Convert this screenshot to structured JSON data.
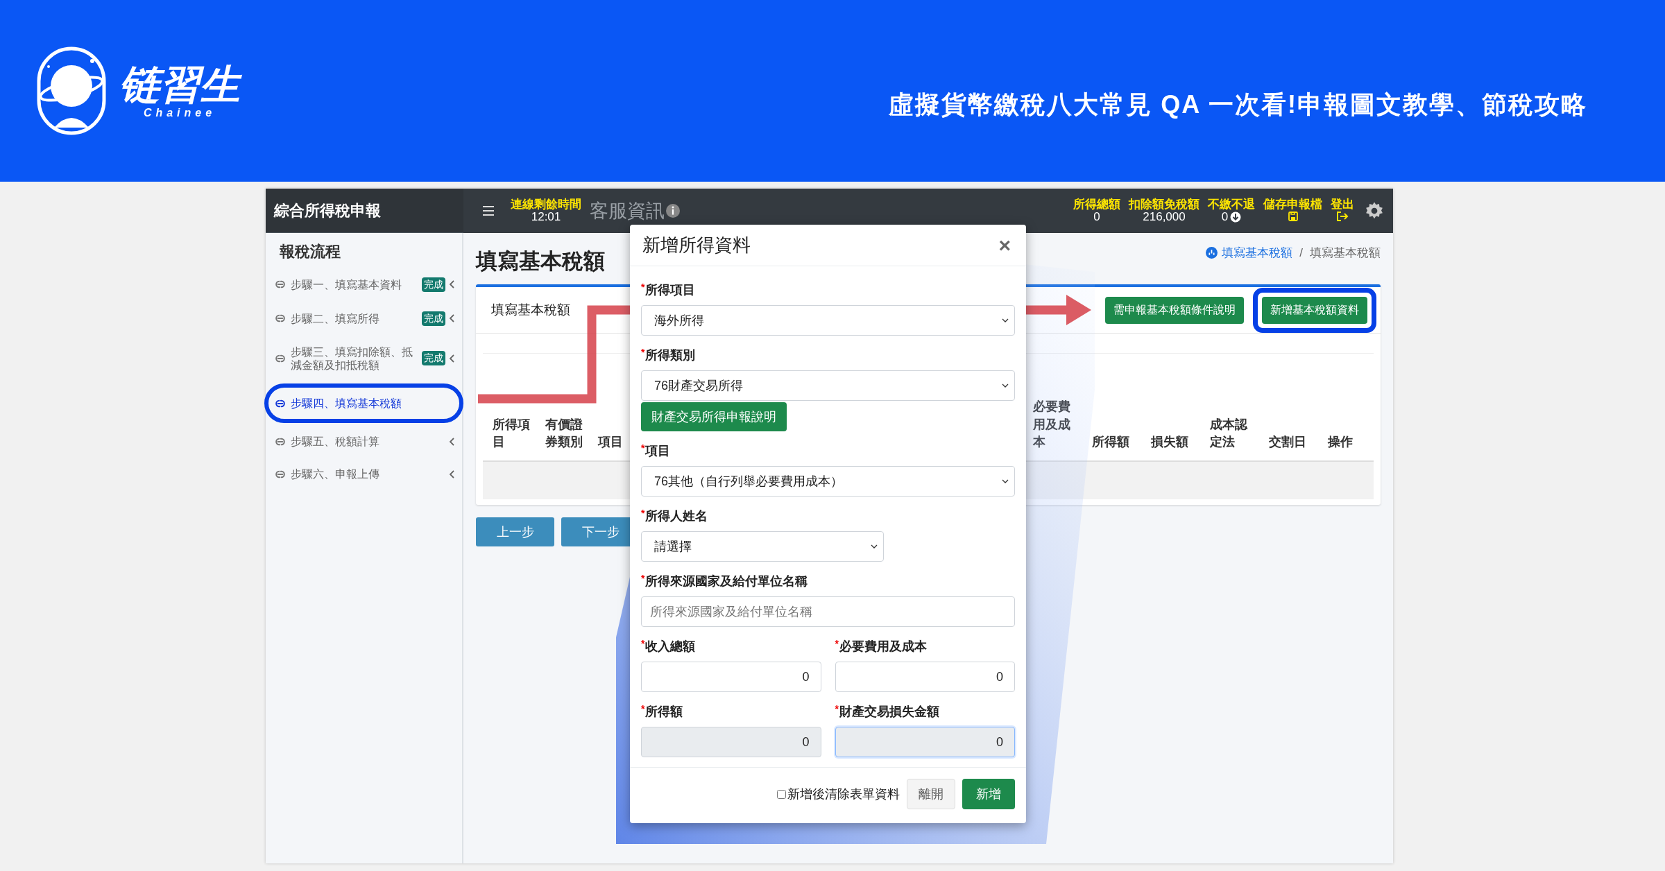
{
  "banner": {
    "logo": {
      "name": "链習生",
      "tagline": "Chainee"
    },
    "title": "虛擬貨幣繳稅八大常見 QA 一次看!申報圖文教學、節稅攻略"
  },
  "topbar": {
    "brand": "綜合所得稅申報",
    "timer": {
      "label": "連線剩餘時間",
      "value": "12:01"
    },
    "support": "客服資訊",
    "stats": [
      {
        "kind": "amount",
        "label": "所得總額",
        "value": "0"
      },
      {
        "kind": "amount",
        "label": "扣除額免稅額",
        "value": "216,000"
      },
      {
        "kind": "status",
        "label": "不繳不退",
        "value": "0"
      },
      {
        "kind": "save",
        "label": "儲存申報檔"
      },
      {
        "kind": "logout",
        "label": "登出"
      }
    ]
  },
  "sidebar": {
    "title": "報稅流程",
    "items": [
      {
        "label": "步驟一、填寫基本資料",
        "badge": "完成",
        "selected": false,
        "highlighted": false
      },
      {
        "label": "步驟二、填寫所得",
        "badge": "完成",
        "selected": false,
        "highlighted": false
      },
      {
        "label": "步驟三、填寫扣除額、抵減金額及扣抵稅額",
        "badge": "完成",
        "selected": false,
        "highlighted": false
      },
      {
        "label": "步驟四、填寫基本稅額",
        "selected": true,
        "highlighted": true
      },
      {
        "label": "步驟五、稅額計算",
        "selected": false,
        "highlighted": false
      },
      {
        "label": "步驟六、申報上傳",
        "selected": false,
        "highlighted": false
      }
    ]
  },
  "content": {
    "title": "填寫基本稅額",
    "breadcrumb_separator": "/",
    "breadcrumb": [
      {
        "label": "填寫基本稅額",
        "link": true
      },
      {
        "label": "填寫基本稅額",
        "link": false
      }
    ],
    "card": {
      "title": "填寫基本稅額",
      "buttons": [
        {
          "label": "需申報基本稅額條件說明",
          "highlighted": false
        },
        {
          "label": "新增基本稅額資料",
          "highlighted": true
        }
      ],
      "columns": [
        "所得項目",
        "有價證券類別",
        "項目",
        "必要費用及成本",
        "所得額",
        "損失額",
        "成本認定法",
        "交割日",
        "操作"
      ]
    },
    "nav_buttons": [
      "上一步",
      "下一步"
    ]
  },
  "modal": {
    "title": "新增所得資料",
    "close": "×",
    "rows": [
      {
        "kind": "full",
        "fields": [
          {
            "kind": "select",
            "mark": "*",
            "label": "所得項目",
            "value": "海外所得"
          }
        ]
      },
      {
        "kind": "full",
        "fields": [
          {
            "kind": "select",
            "mark": "*",
            "label": "所得類別",
            "value": "76財產交易所得"
          },
          {
            "kind": "button",
            "label": "財產交易所得申報說明"
          }
        ]
      },
      {
        "kind": "full",
        "fields": [
          {
            "kind": "select",
            "mark": "*",
            "label": "項目",
            "value": "76其他（自行列舉必要費用成本）"
          }
        ]
      },
      {
        "kind": "short",
        "fields": [
          {
            "kind": "select",
            "mark": "*",
            "label": "所得人姓名",
            "value": "請選擇"
          }
        ]
      },
      {
        "kind": "full",
        "fields": [
          {
            "kind": "text",
            "mark": "*",
            "label": "所得來源國家及給付單位名稱",
            "placeholder": "所得來源國家及給付單位名稱"
          }
        ]
      },
      {
        "kind": "pair",
        "fields": [
          {
            "kind": "number",
            "mark": "*",
            "label": "收入總額",
            "value": "0",
            "readonly": false,
            "focused": false
          },
          {
            "kind": "number",
            "mark": "*",
            "label": "必要費用及成本",
            "value": "0",
            "readonly": false,
            "focused": false
          }
        ]
      },
      {
        "kind": "pair",
        "fields": [
          {
            "kind": "number",
            "mark": "*",
            "label": "所得額",
            "value": "0",
            "readonly": true,
            "focused": false
          },
          {
            "kind": "number",
            "mark": "*",
            "label": "財產交易損失金額",
            "value": "0",
            "readonly": true,
            "focused": true
          }
        ]
      }
    ],
    "footer": {
      "checkbox": {
        "label": "新增後清除表單資料",
        "checked": false
      },
      "buttons": [
        {
          "kind": "secondary",
          "label": "離開"
        },
        {
          "kind": "primary",
          "label": "新增"
        }
      ]
    }
  }
}
